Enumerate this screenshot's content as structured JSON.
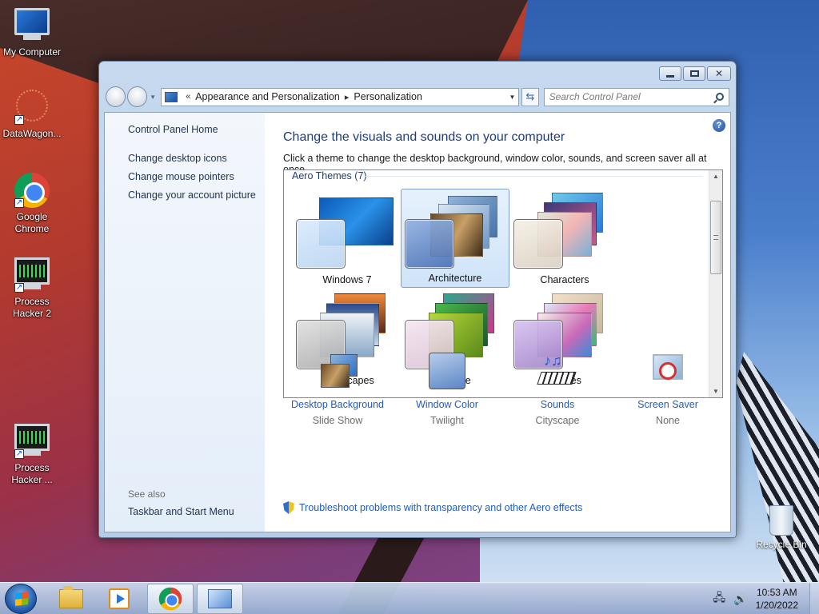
{
  "desktop": {
    "icons": [
      {
        "label": "My Computer"
      },
      {
        "label": "DataWagon..."
      },
      {
        "label": "Google Chrome"
      },
      {
        "label": "Process Hacker 2"
      },
      {
        "label": "Process Hacker ..."
      }
    ],
    "recycle_bin": "Recycle Bin"
  },
  "window": {
    "breadcrumb": {
      "chevron": "«",
      "parts": [
        "Appearance and Personalization",
        "Personalization"
      ],
      "separator": "▸"
    },
    "search_placeholder": "Search Control Panel",
    "left_pane": {
      "home": "Control Panel Home",
      "links": [
        "Change desktop icons",
        "Change mouse pointers",
        "Change your account picture"
      ],
      "see_also_title": "See also",
      "see_also": [
        "Taskbar and Start Menu"
      ]
    },
    "main": {
      "heading": "Change the visuals and sounds on your computer",
      "subtext": "Click a theme to change the desktop background, window color, sounds, and screen saver all at once.",
      "group_title": "Aero Themes (7)",
      "themes": [
        {
          "name": "Windows 7",
          "selected": false
        },
        {
          "name": "Architecture",
          "selected": true
        },
        {
          "name": "Characters",
          "selected": false
        },
        {
          "name": "Landscapes",
          "selected": false
        },
        {
          "name": "Nature",
          "selected": false
        },
        {
          "name": "Scenes",
          "selected": false
        }
      ],
      "settings": [
        {
          "name": "Desktop Background",
          "value": "Slide Show"
        },
        {
          "name": "Window Color",
          "value": "Twilight"
        },
        {
          "name": "Sounds",
          "value": "Cityscape"
        },
        {
          "name": "Screen Saver",
          "value": "None"
        }
      ],
      "troubleshoot": "Troubleshoot problems with transparency and other Aero effects"
    }
  },
  "taskbar": {
    "time": "10:53 AM",
    "date": "1/20/2022"
  }
}
